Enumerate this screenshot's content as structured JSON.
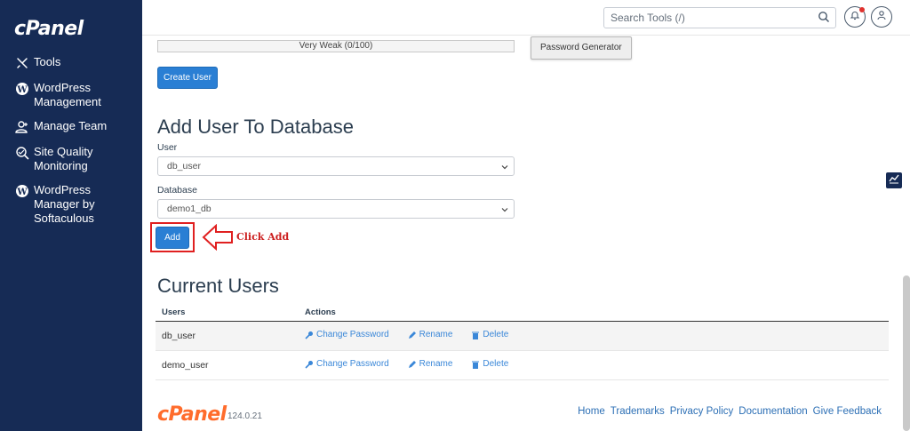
{
  "sidebar": {
    "logo": "cPanel",
    "items": [
      {
        "label": "Tools",
        "icon": "tools-icon"
      },
      {
        "label": "WordPress\nManagement",
        "icon": "wordpress-icon"
      },
      {
        "label": "Manage Team",
        "icon": "team-icon"
      },
      {
        "label": "Site Quality\nMonitoring",
        "icon": "site-quality-icon"
      },
      {
        "label": "WordPress\nManager by\nSoftaculous",
        "icon": "wordpress-icon"
      }
    ]
  },
  "topbar": {
    "search_placeholder": "Search Tools (/)"
  },
  "password": {
    "strength_text": "Very Weak (0/100)",
    "generator_label": "Password Generator",
    "create_user_label": "Create User"
  },
  "add_user": {
    "title": "Add User To Database",
    "user_label": "User",
    "user_value": "db_user",
    "database_label": "Database",
    "database_value": "demo1_db",
    "add_label": "Add",
    "annotation": "Click Add"
  },
  "current_users": {
    "title": "Current Users",
    "columns": [
      "Users",
      "Actions"
    ],
    "actions": {
      "change_password": "Change Password",
      "rename": "Rename",
      "delete": "Delete"
    },
    "rows": [
      {
        "user": "db_user"
      },
      {
        "user": "demo_user"
      }
    ]
  },
  "footer": {
    "logo": "cPanel",
    "version": "124.0.21",
    "links": [
      "Home",
      "Trademarks",
      "Privacy Policy",
      "Documentation",
      "Give Feedback"
    ]
  },
  "colors": {
    "sidebar": "#162b55",
    "primary": "#2a7fd4",
    "link": "#3a87d8",
    "annotation": "#e02020",
    "brand_orange": "#ff6c2c"
  }
}
